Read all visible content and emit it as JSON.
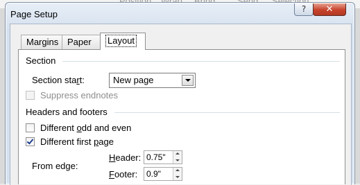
{
  "background": {
    "ribbon_fragments": [
      "Position",
      "Wrap",
      "Bring",
      "Send",
      "Selection"
    ]
  },
  "window": {
    "title": "Page Setup",
    "help_glyph": "?",
    "close_glyph": "✕"
  },
  "tabs": [
    {
      "label": "Margins",
      "selected": false
    },
    {
      "label": "Paper",
      "selected": false
    },
    {
      "label": "Layout",
      "selected": true
    }
  ],
  "section": {
    "heading": "Section",
    "start_label_pre": "Section sta",
    "start_label_ul": "r",
    "start_label_post": "t:",
    "start_value": "New page",
    "suppress_endnotes": {
      "label": "Suppress endnotes",
      "checked": false,
      "enabled": false
    }
  },
  "headers_footers": {
    "heading": "Headers and footers",
    "odd_even": {
      "label_pre": "Different ",
      "label_ul": "o",
      "label_post": "dd and even",
      "checked": false
    },
    "first_page": {
      "label_pre": "Different first ",
      "label_ul": "p",
      "label_post": "age",
      "checked": true
    },
    "from_edge_label": "From edge:",
    "header": {
      "label_ul": "H",
      "label_post": "eader:",
      "value": "0.75\""
    },
    "footer": {
      "label_ul": "F",
      "label_post": "ooter:",
      "value": "0.9\""
    }
  },
  "colors": {
    "close_button": "#c7422b",
    "title_bar": "#d6e1ef",
    "checkmark": "#1f3f8f"
  }
}
